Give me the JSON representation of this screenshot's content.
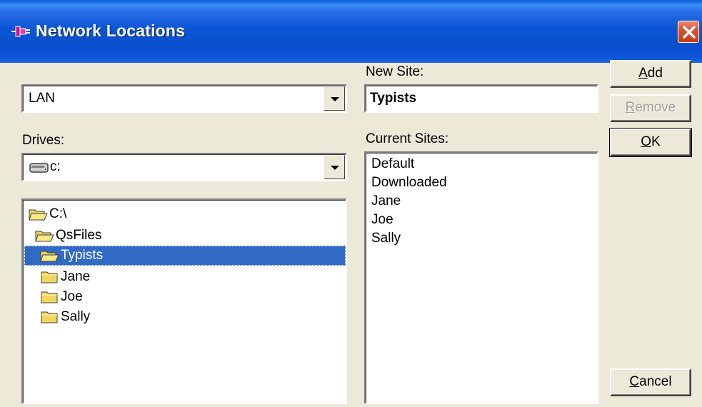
{
  "window": {
    "title": "Network Locations",
    "icon": "network-plug-icon",
    "close_icon": "close-icon"
  },
  "network": {
    "selected": "LAN"
  },
  "drives": {
    "label": "Drives:",
    "selected": "c:"
  },
  "folders": [
    {
      "label": "C:\\",
      "depth": 0,
      "selected": false,
      "open": true
    },
    {
      "label": "QsFiles",
      "depth": 1,
      "selected": false,
      "open": true
    },
    {
      "label": "Typists",
      "depth": 2,
      "selected": true,
      "open": true
    },
    {
      "label": "Jane",
      "depth": 3,
      "selected": false,
      "open": false
    },
    {
      "label": "Joe",
      "depth": 3,
      "selected": false,
      "open": false
    },
    {
      "label": "Sally",
      "depth": 3,
      "selected": false,
      "open": false
    }
  ],
  "new_site": {
    "label": "New Site:",
    "value": "Typists"
  },
  "current_sites": {
    "label": "Current Sites:",
    "items": [
      "Default",
      "Downloaded",
      "Jane",
      "Joe",
      "Sally"
    ]
  },
  "buttons": {
    "add_mnemonic": "A",
    "add_rest": "dd",
    "remove_mnemonic": "R",
    "remove_rest": "emove",
    "ok_mnemonic": "O",
    "ok_rest": "K",
    "cancel_mnemonic": "C",
    "cancel_rest": "ancel"
  },
  "colors": {
    "titlebar": "#0b56d6",
    "selection": "#316ac5",
    "face": "#ece9d8",
    "close": "#c63b18"
  }
}
